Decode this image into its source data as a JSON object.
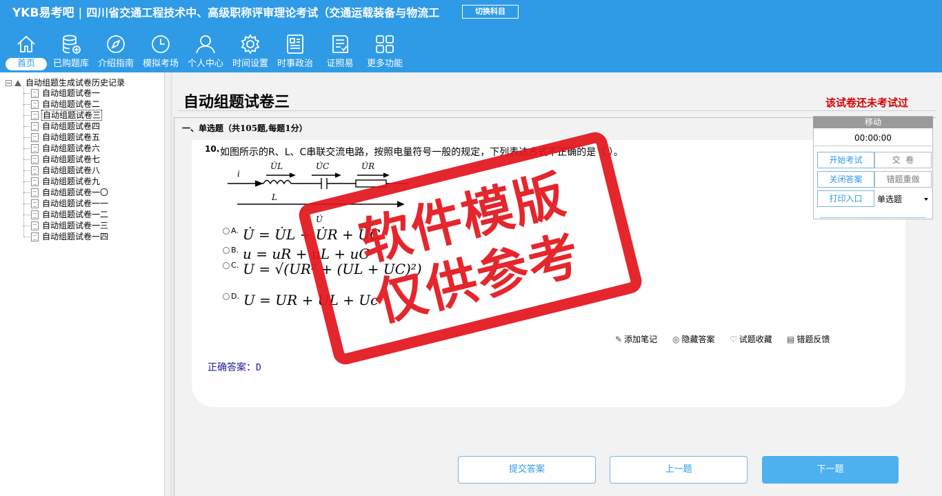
{
  "header": {
    "brand": "YKB易考吧",
    "separator": "|",
    "exam_title": "四川省交通工程技术中、高级职称评审理论考试（交通运载装备与物流工",
    "switch_label": "切换科目"
  },
  "nav": [
    {
      "label": "首页",
      "icon": "home-icon"
    },
    {
      "label": "已购题库",
      "icon": "database-icon"
    },
    {
      "label": "介绍指南",
      "icon": "compass-icon"
    },
    {
      "label": "模拟考场",
      "icon": "clock-icon"
    },
    {
      "label": "个人中心",
      "icon": "user-icon"
    },
    {
      "label": "时间设置",
      "icon": "gear-icon"
    },
    {
      "label": "时事政治",
      "icon": "newspaper-icon"
    },
    {
      "label": "证照易",
      "icon": "certificate-icon"
    },
    {
      "label": "更多功能",
      "icon": "grid-icon"
    }
  ],
  "tree": {
    "root": "自动组题生成试卷历史记录",
    "items": [
      "自动组题试卷一",
      "自动组题试卷二",
      "自动组题试卷三",
      "自动组题试卷四",
      "自动组题试卷五",
      "自动组题试卷六",
      "自动组题试卷七",
      "自动组题试卷八",
      "自动组题试卷九",
      "自动组题试卷一〇",
      "自动组题试卷一一",
      "自动组题试卷一二",
      "自动组题试卷一三",
      "自动组题试卷一四"
    ],
    "selected_index": 2
  },
  "paper": {
    "title": "自动组题试卷三",
    "status": "该试卷还未考试过",
    "section": "一、单选题（共105题,每题1分）"
  },
  "question": {
    "number": "10.",
    "text": "如图所示的R、L、C串联交流电路，按照电量符号一般的规定，下列表达方式不正确的是（ ）。",
    "figure": {
      "current": "i",
      "ul": "U̇L",
      "uc": "U̇C",
      "ur": "U̇R",
      "l": "L",
      "u": "U̇"
    },
    "options": [
      {
        "key": "A.",
        "formula": "U̇ = U̇L + U̇R + U̇C"
      },
      {
        "key": "B.",
        "formula": "u = uR + uL + uC"
      },
      {
        "key": "C.",
        "formula": "U = √(UR² + (UL + UC)²)"
      },
      {
        "key": "D.",
        "formula": "U = UR + UL + Uc"
      }
    ]
  },
  "tools": {
    "note": "添加笔记",
    "hide_answer": "隐藏答案",
    "favorite": "试题收藏",
    "feedback": "错题反馈"
  },
  "answer": {
    "label": "正确答案：",
    "value": "D"
  },
  "bottom_buttons": {
    "submit": "提交答案",
    "prev": "上一题",
    "next": "下一题"
  },
  "widget": {
    "move": "移动",
    "timer": "00:00:00",
    "start": "开始考试",
    "submit": "交  卷",
    "close_answer": "关闭答案",
    "redo_wrong": "错题重做",
    "print": "打印入口",
    "type_select": "单选题"
  },
  "watermark": {
    "line1": "软件模版",
    "line2": "仅供参考"
  },
  "colors": {
    "primary": "#2f9be6",
    "status_red": "#d60000",
    "stamp_red": "#e3141b",
    "answer_blue": "#1a1a9a"
  }
}
